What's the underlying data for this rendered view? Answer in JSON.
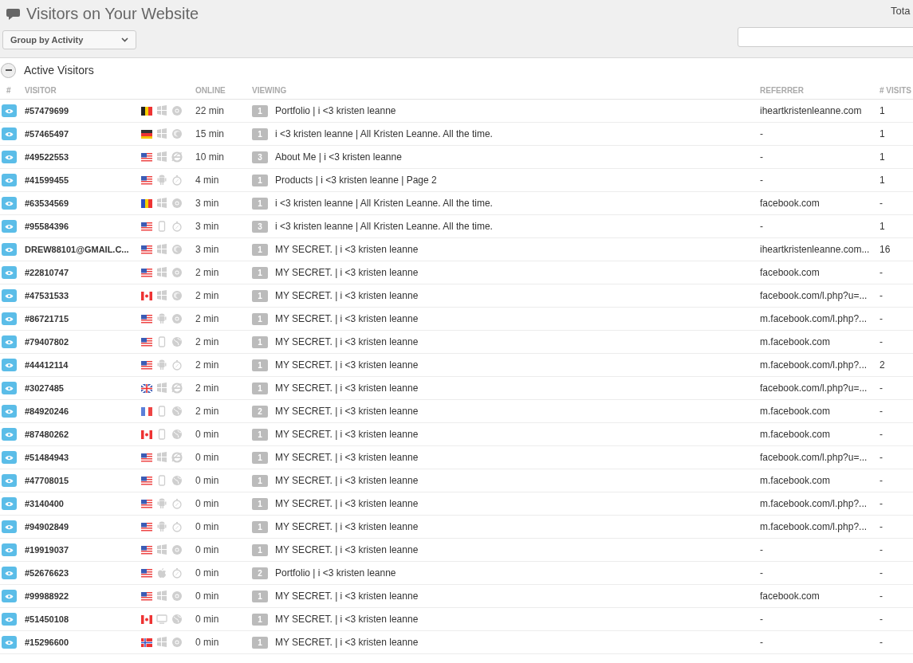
{
  "header": {
    "title": "Visitors on Your Website",
    "group_select": "Group by Activity",
    "total_label": "Tota"
  },
  "section": {
    "title": "Active Visitors",
    "expanded": true
  },
  "table": {
    "columns": [
      "#",
      "VISITOR",
      "ONLINE",
      "VIEWING",
      "REFERRER",
      "# VISITS"
    ],
    "rows": [
      {
        "visitor": "#57479699",
        "icons": [
          {
            "kind": "flag_be"
          },
          {
            "kind": "windows"
          },
          {
            "kind": "chrome"
          }
        ],
        "online": "22 min",
        "views": "1",
        "page": "Portfolio | i <3 kristen leanne",
        "referrer": "iheartkristenleanne.com",
        "visits": "1"
      },
      {
        "visitor": "#57465497",
        "icons": [
          {
            "kind": "flag_de"
          },
          {
            "kind": "windows"
          },
          {
            "kind": "firefox"
          }
        ],
        "online": "15 min",
        "views": "1",
        "page": "i <3 kristen leanne | All Kristen Leanne. All the time.",
        "referrer": "-",
        "visits": "1"
      },
      {
        "visitor": "#49522553",
        "icons": [
          {
            "kind": "flag_us"
          },
          {
            "kind": "windows"
          },
          {
            "kind": "ie"
          }
        ],
        "online": "10 min",
        "views": "3",
        "page": "About Me | i <3 kristen leanne",
        "referrer": "-",
        "visits": "1"
      },
      {
        "visitor": "#41599455",
        "icons": [
          {
            "kind": "flag_us"
          },
          {
            "kind": "android"
          },
          {
            "kind": "safari"
          }
        ],
        "online": "4 min",
        "views": "1",
        "page": "Products | i <3 kristen leanne | Page 2",
        "referrer": "-",
        "visits": "1"
      },
      {
        "visitor": "#63534569",
        "icons": [
          {
            "kind": "flag_ro"
          },
          {
            "kind": "windows"
          },
          {
            "kind": "chrome"
          }
        ],
        "online": "3 min",
        "views": "1",
        "page": "i <3 kristen leanne | All Kristen Leanne. All the time.",
        "referrer": "facebook.com",
        "visits": "-"
      },
      {
        "visitor": "#95584396",
        "icons": [
          {
            "kind": "flag_us"
          },
          {
            "kind": "phone"
          },
          {
            "kind": "safari"
          }
        ],
        "online": "3 min",
        "views": "3",
        "page": "i <3 kristen leanne | All Kristen Leanne. All the time.",
        "referrer": "-",
        "visits": "1"
      },
      {
        "visitor": "DREW88101@GMAIL.C...",
        "icons": [
          {
            "kind": "flag_us"
          },
          {
            "kind": "windows"
          },
          {
            "kind": "firefox"
          }
        ],
        "online": "3 min",
        "views": "1",
        "page": "MY SECRET. | i <3 kristen leanne",
        "referrer": "iheartkristenleanne.com...",
        "visits": "16"
      },
      {
        "visitor": "#22810747",
        "icons": [
          {
            "kind": "flag_us"
          },
          {
            "kind": "windows"
          },
          {
            "kind": "chrome"
          }
        ],
        "online": "2 min",
        "views": "1",
        "page": "MY SECRET. | i <3 kristen leanne",
        "referrer": "facebook.com",
        "visits": "-"
      },
      {
        "visitor": "#47531533",
        "icons": [
          {
            "kind": "flag_ca"
          },
          {
            "kind": "windows"
          },
          {
            "kind": "firefox"
          }
        ],
        "online": "2 min",
        "views": "1",
        "page": "MY SECRET. | i <3 kristen leanne",
        "referrer": "facebook.com/l.php?u=...",
        "visits": "-"
      },
      {
        "visitor": "#86721715",
        "icons": [
          {
            "kind": "flag_us"
          },
          {
            "kind": "android"
          },
          {
            "kind": "chrome"
          }
        ],
        "online": "2 min",
        "views": "1",
        "page": "MY SECRET. | i <3 kristen leanne",
        "referrer": "m.facebook.com/l.php?...",
        "visits": "-"
      },
      {
        "visitor": "#79407802",
        "icons": [
          {
            "kind": "flag_us"
          },
          {
            "kind": "phone"
          },
          {
            "kind": "globe"
          }
        ],
        "online": "2 min",
        "views": "1",
        "page": "MY SECRET. | i <3 kristen leanne",
        "referrer": "m.facebook.com",
        "visits": "-"
      },
      {
        "visitor": "#44412114",
        "icons": [
          {
            "kind": "flag_us"
          },
          {
            "kind": "android"
          },
          {
            "kind": "safari"
          }
        ],
        "online": "2 min",
        "views": "1",
        "page": "MY SECRET. | i <3 kristen leanne",
        "referrer": "m.facebook.com/l.php?...",
        "visits": "2"
      },
      {
        "visitor": "#3027485",
        "icons": [
          {
            "kind": "flag_gb"
          },
          {
            "kind": "windows"
          },
          {
            "kind": "ie"
          }
        ],
        "online": "2 min",
        "views": "1",
        "page": "MY SECRET. | i <3 kristen leanne",
        "referrer": "facebook.com/l.php?u=...",
        "visits": "-"
      },
      {
        "visitor": "#84920246",
        "icons": [
          {
            "kind": "flag_fr"
          },
          {
            "kind": "phone"
          },
          {
            "kind": "globe"
          }
        ],
        "online": "2 min",
        "views": "2",
        "page": "MY SECRET. | i <3 kristen leanne",
        "referrer": "m.facebook.com",
        "visits": "-"
      },
      {
        "visitor": "#87480262",
        "icons": [
          {
            "kind": "flag_ca"
          },
          {
            "kind": "phone"
          },
          {
            "kind": "globe"
          }
        ],
        "online": "0 min",
        "views": "1",
        "page": "MY SECRET. | i <3 kristen leanne",
        "referrer": "m.facebook.com",
        "visits": "-"
      },
      {
        "visitor": "#51484943",
        "icons": [
          {
            "kind": "flag_us"
          },
          {
            "kind": "windows"
          },
          {
            "kind": "ie"
          }
        ],
        "online": "0 min",
        "views": "1",
        "page": "MY SECRET. | i <3 kristen leanne",
        "referrer": "facebook.com/l.php?u=...",
        "visits": "-"
      },
      {
        "visitor": "#47708015",
        "icons": [
          {
            "kind": "flag_us"
          },
          {
            "kind": "phone"
          },
          {
            "kind": "globe"
          }
        ],
        "online": "0 min",
        "views": "1",
        "page": "MY SECRET. | i <3 kristen leanne",
        "referrer": "m.facebook.com",
        "visits": "-"
      },
      {
        "visitor": "#3140400",
        "icons": [
          {
            "kind": "flag_us"
          },
          {
            "kind": "android"
          },
          {
            "kind": "safari"
          }
        ],
        "online": "0 min",
        "views": "1",
        "page": "MY SECRET. | i <3 kristen leanne",
        "referrer": "m.facebook.com/l.php?...",
        "visits": "-"
      },
      {
        "visitor": "#94902849",
        "icons": [
          {
            "kind": "flag_us"
          },
          {
            "kind": "android"
          },
          {
            "kind": "safari"
          }
        ],
        "online": "0 min",
        "views": "1",
        "page": "MY SECRET. | i <3 kristen leanne",
        "referrer": "m.facebook.com/l.php?...",
        "visits": "-"
      },
      {
        "visitor": "#19919037",
        "icons": [
          {
            "kind": "flag_us"
          },
          {
            "kind": "windows"
          },
          {
            "kind": "chrome"
          }
        ],
        "online": "0 min",
        "views": "1",
        "page": "MY SECRET. | i <3 kristen leanne",
        "referrer": "-",
        "visits": "-"
      },
      {
        "visitor": "#52676623",
        "icons": [
          {
            "kind": "flag_us"
          },
          {
            "kind": "apple"
          },
          {
            "kind": "safari"
          }
        ],
        "online": "0 min",
        "views": "2",
        "page": "Portfolio | i <3 kristen leanne",
        "referrer": "-",
        "visits": "-"
      },
      {
        "visitor": "#99988922",
        "icons": [
          {
            "kind": "flag_us"
          },
          {
            "kind": "windows"
          },
          {
            "kind": "chrome"
          }
        ],
        "online": "0 min",
        "views": "1",
        "page": "MY SECRET. | i <3 kristen leanne",
        "referrer": "facebook.com",
        "visits": "-"
      },
      {
        "visitor": "#51450108",
        "icons": [
          {
            "kind": "flag_ca"
          },
          {
            "kind": "desktop"
          },
          {
            "kind": "globe"
          }
        ],
        "online": "0 min",
        "views": "1",
        "page": "MY SECRET. | i <3 kristen leanne",
        "referrer": "-",
        "visits": "-"
      },
      {
        "visitor": "#15296600",
        "icons": [
          {
            "kind": "flag_no"
          },
          {
            "kind": "windows"
          },
          {
            "kind": "chrome"
          }
        ],
        "online": "0 min",
        "views": "1",
        "page": "MY SECRET. | i <3 kristen leanne",
        "referrer": "-",
        "visits": "-"
      }
    ]
  }
}
